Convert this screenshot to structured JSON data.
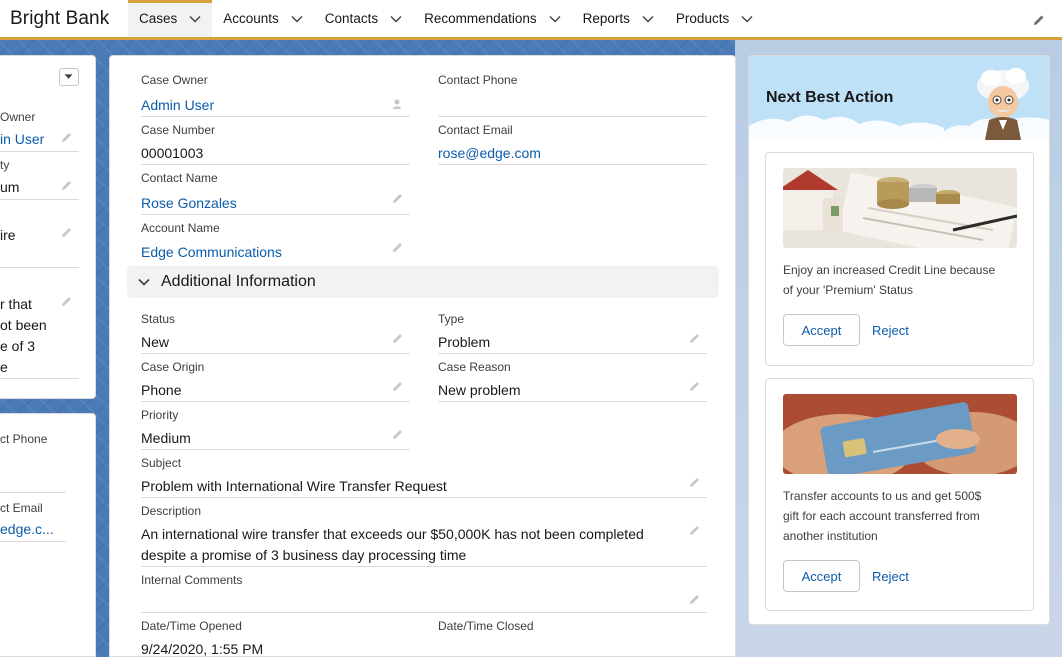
{
  "app": {
    "name": "Bright Bank"
  },
  "nav": {
    "tabs": [
      {
        "label": "Cases",
        "active": true
      },
      {
        "label": "Accounts"
      },
      {
        "label": "Contacts"
      },
      {
        "label": "Recommendations"
      },
      {
        "label": "Reports"
      },
      {
        "label": "Products"
      }
    ]
  },
  "left_panel": {
    "owner_label": "Owner",
    "owner_value": "in User",
    "priority_label": "ty",
    "priority_value": "um",
    "subject_partial": "ire",
    "desc_lines": [
      "r that",
      "ot been",
      "e of 3",
      "e"
    ],
    "phone_label": "ct Phone",
    "email_label": "ct Email",
    "email_value": "edge.c..."
  },
  "details": {
    "case_owner_label": "Case Owner",
    "case_owner_value": "Admin User",
    "contact_phone_label": "Contact Phone",
    "contact_phone_value": "",
    "case_number_label": "Case Number",
    "case_number_value": "00001003",
    "contact_email_label": "Contact Email",
    "contact_email_value": "rose@edge.com",
    "contact_name_label": "Contact Name",
    "contact_name_value": "Rose Gonzales",
    "account_name_label": "Account Name",
    "account_name_value": "Edge Communications"
  },
  "additional": {
    "section_title": "Additional Information",
    "status_label": "Status",
    "status_value": "New",
    "type_label": "Type",
    "type_value": "Problem",
    "origin_label": "Case Origin",
    "origin_value": "Phone",
    "reason_label": "Case Reason",
    "reason_value": "New problem",
    "priority_label": "Priority",
    "priority_value": "Medium",
    "subject_label": "Subject",
    "subject_value": "Problem with International Wire Transfer Request",
    "description_label": "Description",
    "description_line1": "An international wire transfer that exceeds our $50,000K has not been completed",
    "description_line2": "despite a promise of 3 business day processing time",
    "internal_comments_label": "Internal Comments",
    "internal_comments_value": "",
    "opened_label": "Date/Time Opened",
    "opened_value": "9/24/2020, 1:55 PM",
    "closed_label": "Date/Time Closed",
    "closed_value": ""
  },
  "nba": {
    "title": "Next Best Action",
    "offers": [
      {
        "text_line1": "Enjoy an increased Credit Line because",
        "text_line2": "of your 'Premium' Status",
        "accept": "Accept",
        "reject": "Reject"
      },
      {
        "text_line1": "Transfer accounts to us and get 500$",
        "text_line2": "gift for each account transferred from",
        "text_line3": "another institution",
        "accept": "Accept",
        "reject": "Reject"
      }
    ]
  },
  "colors": {
    "accent": "#d4a13d",
    "link": "#0b5cab",
    "nba_header": "#bfe1f7"
  }
}
